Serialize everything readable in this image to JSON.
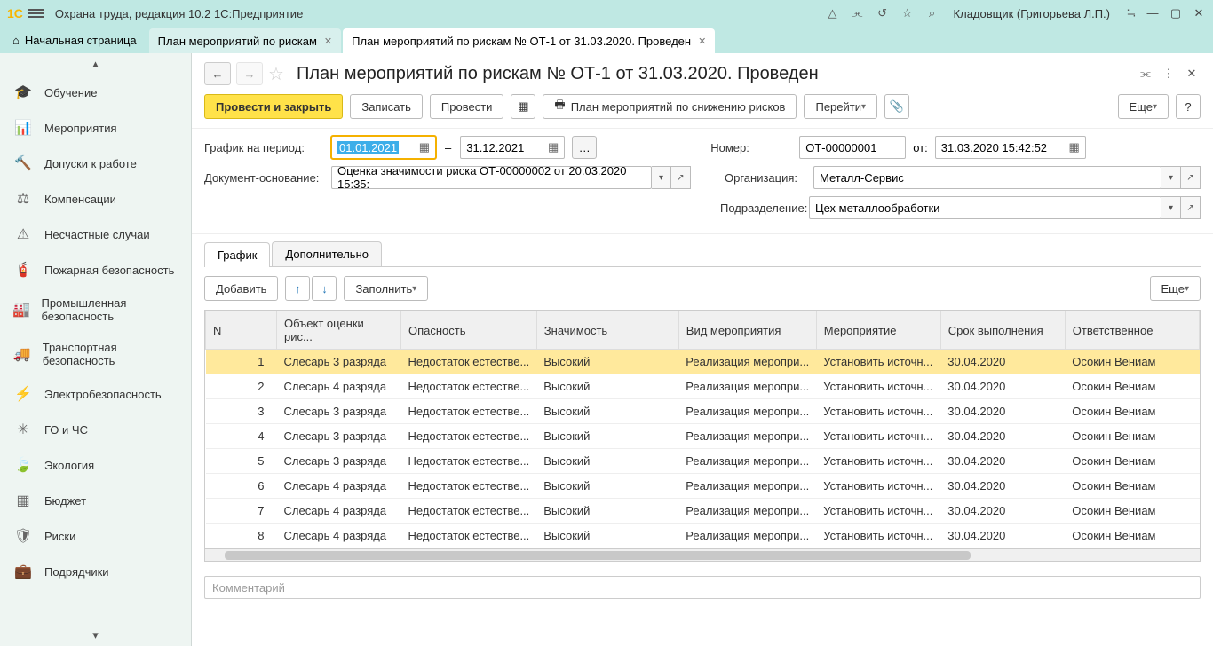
{
  "titlebar": {
    "app_title": "Охрана труда, редакция 10.2 1С:Предприятие",
    "user": "Кладовщик (Григорьева Л.П.)"
  },
  "tabs": {
    "home": "Начальная страница",
    "t1": "План мероприятий по рискам",
    "t2": "План мероприятий по рискам № ОТ-1 от 31.03.2020. Проведен"
  },
  "sidebar": [
    "Обучение",
    "Мероприятия",
    "Допуски к работе",
    "Компенсации",
    "Несчастные случаи",
    "Пожарная безопасность",
    "Промышленная безопасность",
    "Транспортная безопасность",
    "Электробезопасность",
    "ГО и ЧС",
    "Экология",
    "Бюджет",
    "Риски",
    "Подрядчики"
  ],
  "doc": {
    "title": "План мероприятий по рискам № ОТ-1 от 31.03.2020. Проведен"
  },
  "toolbar": {
    "post_close": "Провести и закрыть",
    "save": "Записать",
    "post": "Провести",
    "print_plan": "План мероприятий по снижению рисков",
    "goto": "Перейти",
    "more": "Еще"
  },
  "form": {
    "period_label": "График на период:",
    "period_from": "01.01.2021",
    "period_to": "31.12.2021",
    "basis_label": "Документ-основание:",
    "basis_value": "Оценка значимости риска ОТ-00000002 от 20.03.2020 15:35:",
    "number_label": "Номер:",
    "number_value": "ОТ-00000001",
    "date_label": "от:",
    "date_value": "31.03.2020 15:42:52",
    "org_label": "Организация:",
    "org_value": "Металл-Сервис",
    "dept_label": "Подразделение:",
    "dept_value": "Цех металлообработки"
  },
  "content_tabs": {
    "tab1": "График",
    "tab2": "Дополнительно"
  },
  "tbl_toolbar": {
    "add": "Добавить",
    "fill": "Заполнить",
    "more": "Еще"
  },
  "table": {
    "headers": {
      "n": "N",
      "obj": "Объект оценки рис...",
      "danger": "Опасность",
      "sig": "Значимость",
      "kind": "Вид мероприятия",
      "act": "Мероприятие",
      "due": "Срок выполнения",
      "resp": "Ответственное"
    },
    "rows": [
      {
        "n": "1",
        "obj": "Слесарь 3 разряда",
        "d": "Недостаток естестве...",
        "s": "Высокий",
        "k": "Реализация меропри...",
        "a": "Установить источн...",
        "due": "30.04.2020",
        "r": "Осокин Вениам"
      },
      {
        "n": "2",
        "obj": "Слесарь 4 разряда",
        "d": "Недостаток естестве...",
        "s": "Высокий",
        "k": "Реализация меропри...",
        "a": "Установить источн...",
        "due": "30.04.2020",
        "r": "Осокин Вениам"
      },
      {
        "n": "3",
        "obj": "Слесарь 3 разряда",
        "d": "Недостаток естестве...",
        "s": "Высокий",
        "k": "Реализация меропри...",
        "a": "Установить источн...",
        "due": "30.04.2020",
        "r": "Осокин Вениам"
      },
      {
        "n": "4",
        "obj": "Слесарь 3 разряда",
        "d": "Недостаток естестве...",
        "s": "Высокий",
        "k": "Реализация меропри...",
        "a": "Установить источн...",
        "due": "30.04.2020",
        "r": "Осокин Вениам"
      },
      {
        "n": "5",
        "obj": "Слесарь 3 разряда",
        "d": "Недостаток естестве...",
        "s": "Высокий",
        "k": "Реализация меропри...",
        "a": "Установить источн...",
        "due": "30.04.2020",
        "r": "Осокин Вениам"
      },
      {
        "n": "6",
        "obj": "Слесарь 4 разряда",
        "d": "Недостаток естестве...",
        "s": "Высокий",
        "k": "Реализация меропри...",
        "a": "Установить источн...",
        "due": "30.04.2020",
        "r": "Осокин Вениам"
      },
      {
        "n": "7",
        "obj": "Слесарь 4 разряда",
        "d": "Недостаток естестве...",
        "s": "Высокий",
        "k": "Реализация меропри...",
        "a": "Установить источн...",
        "due": "30.04.2020",
        "r": "Осокин Вениам"
      },
      {
        "n": "8",
        "obj": "Слесарь 4 разряда",
        "d": "Недостаток естестве...",
        "s": "Высокий",
        "k": "Реализация меропри...",
        "a": "Установить источн...",
        "due": "30.04.2020",
        "r": "Осокин Вениам"
      }
    ]
  },
  "comment": {
    "placeholder": "Комментарий"
  },
  "help": "?"
}
